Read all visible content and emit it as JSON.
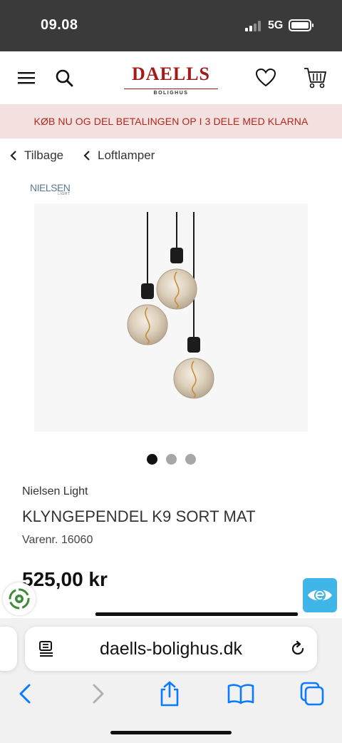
{
  "status_bar": {
    "time": "09.08",
    "network": "5G"
  },
  "header": {
    "brand": "DAELLS",
    "brand_sub": "BOLIGHUS"
  },
  "banner": {
    "text": "KØB NU OG DEL BETALINGEN OP I 3 DELE MED KLARNA"
  },
  "breadcrumbs": {
    "back": "Tilbage",
    "category": "Loftlamper"
  },
  "brand_logo": {
    "name": "NIELSEN",
    "sub": "LIGHT"
  },
  "product": {
    "vendor": "Nielsen Light",
    "title": "KLYNGEPENDEL K9 SORT MAT",
    "sku": "Varenr. 16060",
    "price": "525,00 kr",
    "image_count": 3,
    "active_image": 1
  },
  "browser": {
    "url": "daells-bolighus.dk"
  },
  "icons": {
    "menu": "hamburger-icon",
    "search": "search-icon",
    "wishlist": "heart-icon",
    "cart": "cart-icon",
    "reader": "reader-icon",
    "reload": "reload-icon",
    "back": "chevron-left-icon",
    "forward": "chevron-right-icon",
    "share": "share-icon",
    "bookmarks": "book-icon",
    "tabs": "tabs-icon"
  },
  "colors": {
    "brand_red": "#a11b1b",
    "banner_bg": "#f3e1e0",
    "banner_text": "#b3261e",
    "safari_blue": "#0a7aff",
    "trust_blue": "#3fb5e8"
  }
}
